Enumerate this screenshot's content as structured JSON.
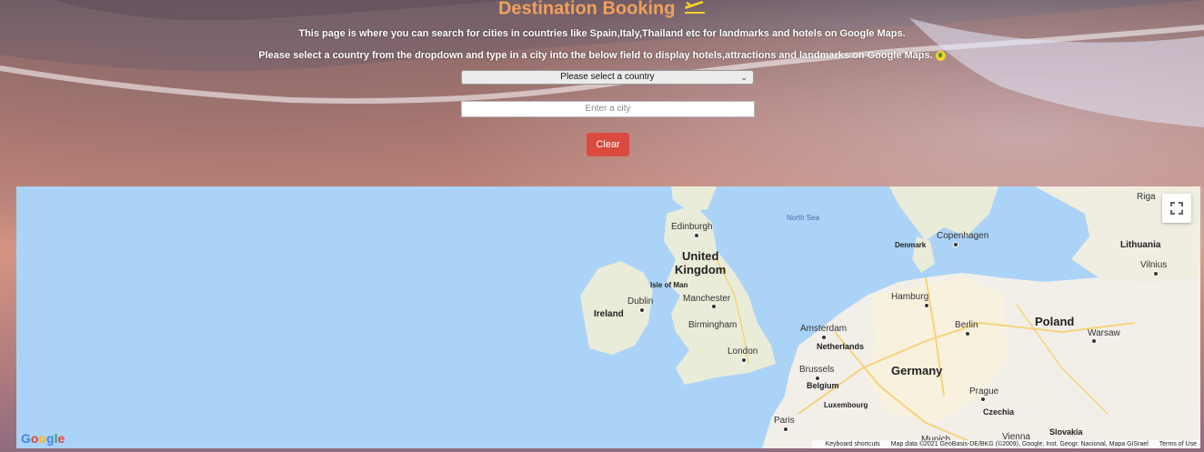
{
  "header": {
    "title": "Destination Booking",
    "description_1": "This page is where you can search for cities in countries like Spain,Italy,Thailand etc for landmarks and hotels on Google Maps.",
    "description_2": "Please select a country from the dropdown and type in a city into the below field to display hotels,attractions and landmarks on Google Maps."
  },
  "form": {
    "country_select": "Please select a country",
    "city_placeholder": "Enter a city",
    "clear_label": "Clear"
  },
  "map": {
    "labels": {
      "north_sea": "North Sea",
      "riga": "Riga",
      "edinburgh": "Edinburgh",
      "united": "United",
      "kingdom": "Kingdom",
      "denmark": "Denmark",
      "copenhagen": "Copenhagen",
      "lithuania": "Lithuania",
      "vilnius": "Vilnius",
      "isle_of_man": "Isle of Man",
      "dublin": "Dublin",
      "ireland": "Ireland",
      "manchester": "Manchester",
      "hamburg": "Hamburg",
      "birmingham": "Birmingham",
      "amsterdam": "Amsterdam",
      "berlin": "Berlin",
      "poland": "Poland",
      "warsaw": "Warsaw",
      "netherlands": "Netherlands",
      "london": "London",
      "brussels": "Brussels",
      "germany": "Germany",
      "belgium": "Belgium",
      "luxembourg": "Luxembourg",
      "prague": "Prague",
      "czechia": "Czechia",
      "paris": "Paris",
      "slovakia": "Slovakia",
      "vienna": "Vienna",
      "munich": "Munich"
    },
    "google_logo": "Google",
    "attribution": {
      "keyboard": "Keyboard shortcuts",
      "data": "Map data ©2021 GeoBasis-DE/BKG (©2009), Google, Inst. Geogr. Nacional, Mapa GISrael",
      "terms": "Terms of Use"
    }
  },
  "colors": {
    "title": "#f2a05a",
    "clear_button": "#db4a3f",
    "water": "#aad3f7",
    "land": "#f2efe9"
  }
}
